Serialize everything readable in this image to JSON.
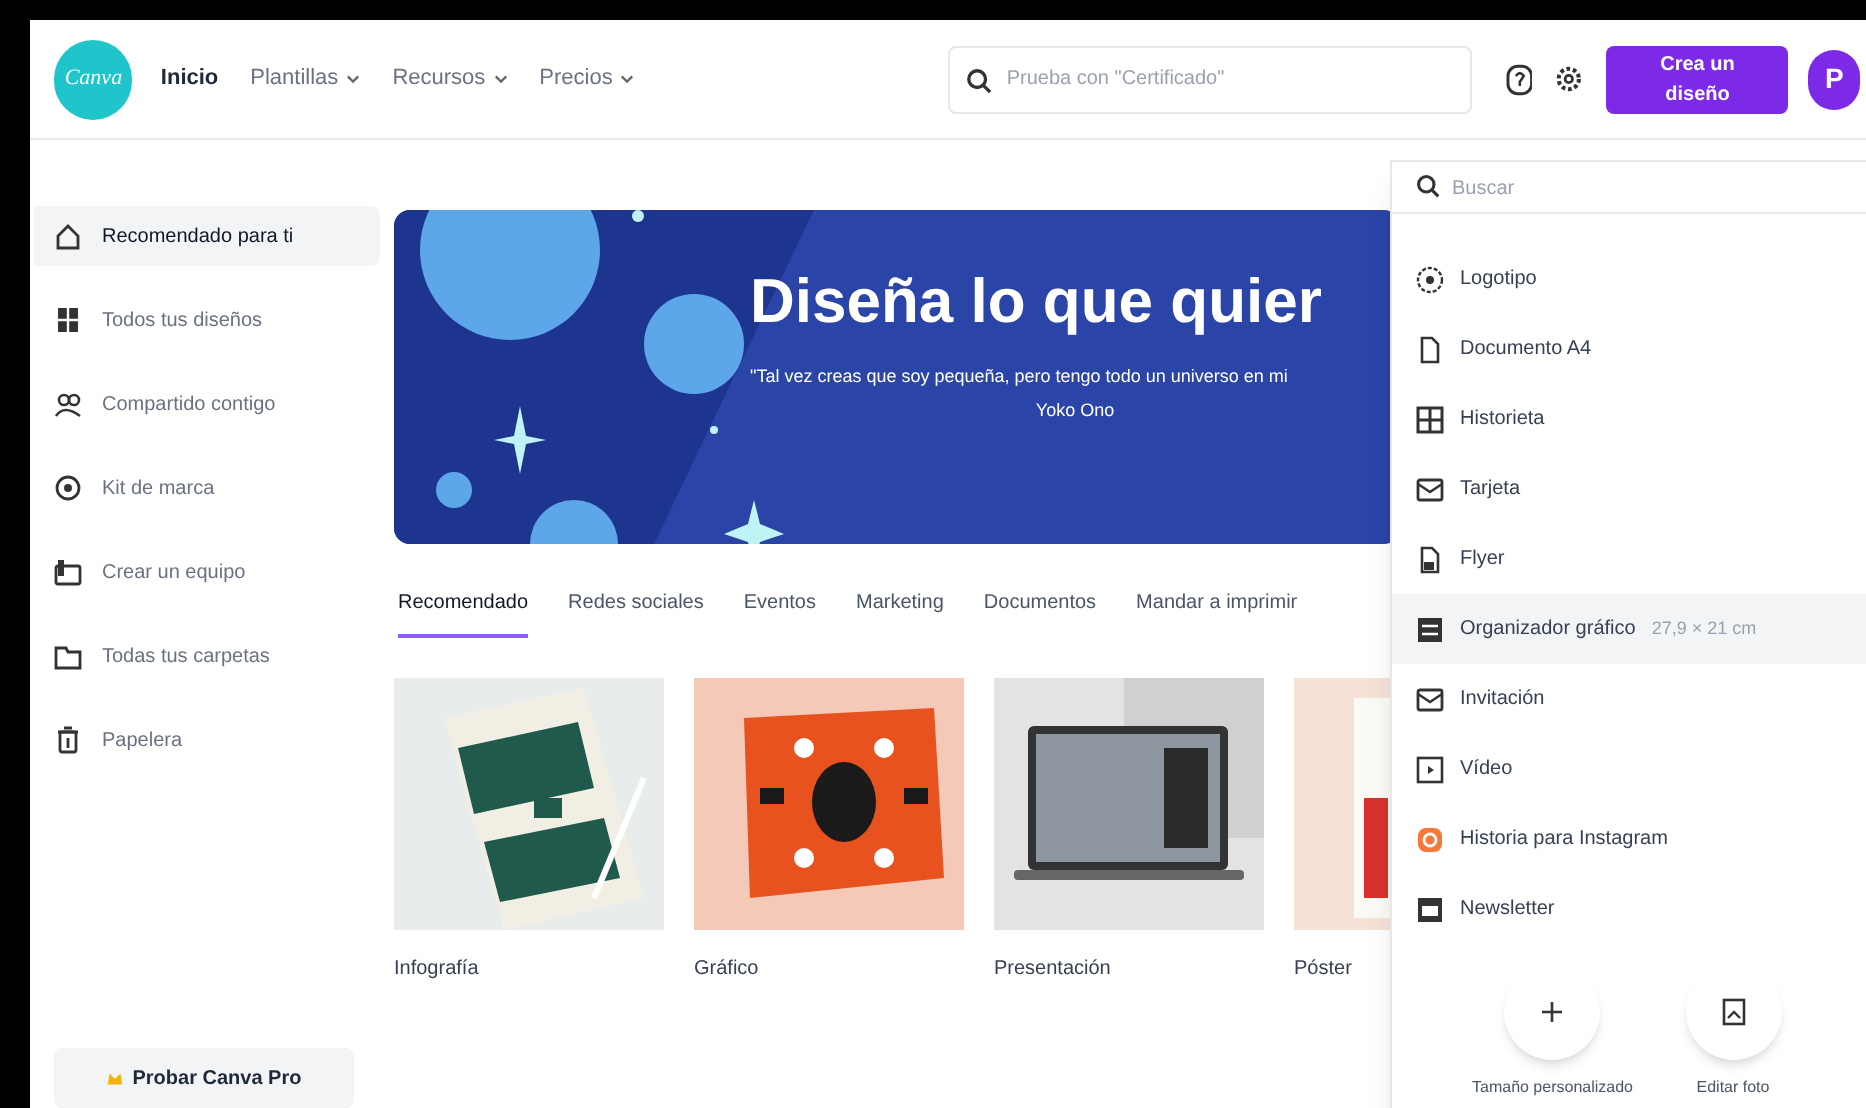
{
  "header": {
    "logo": "Canva",
    "nav": [
      {
        "label": "Inicio",
        "dropdown": false
      },
      {
        "label": "Plantillas",
        "dropdown": true
      },
      {
        "label": "Recursos",
        "dropdown": true
      },
      {
        "label": "Precios",
        "dropdown": true
      }
    ],
    "search": {
      "placeholder": "Prueba con \"Certificado\""
    },
    "create_button": "Crea un diseño",
    "avatar": "P"
  },
  "sidebar": {
    "items": [
      {
        "label": "Recomendado para ti",
        "selected": true
      },
      {
        "label": "Todos tus diseños",
        "selected": false
      },
      {
        "label": "Compartido contigo",
        "selected": false
      },
      {
        "label": "Kit de marca",
        "selected": false
      },
      {
        "label": "Crear un equipo",
        "selected": false
      },
      {
        "label": "Todas tus carpetas",
        "selected": false
      },
      {
        "label": "Papelera",
        "selected": false
      }
    ],
    "pro_button": "Probar Canva Pro"
  },
  "banner": {
    "title": "Diseña lo que quier",
    "quote": "\"Tal vez creas que soy pequeña, pero tengo todo un universo en mi",
    "author": "Yoko Ono"
  },
  "tabs": [
    {
      "label": "Recomendado",
      "selected": true
    },
    {
      "label": "Redes sociales",
      "selected": false
    },
    {
      "label": "Eventos",
      "selected": false
    },
    {
      "label": "Marketing",
      "selected": false
    },
    {
      "label": "Documentos",
      "selected": false
    },
    {
      "label": "Mandar a imprimir",
      "selected": false
    }
  ],
  "cards": [
    {
      "label": "Infografía",
      "kind": "picture"
    },
    {
      "label": "Gráfico",
      "kind": "picture"
    },
    {
      "label": "Presentación",
      "kind": "picture"
    },
    {
      "label": "Póster",
      "kind": "picture"
    }
  ],
  "dropdown": {
    "search": {
      "placeholder": "Buscar"
    },
    "items": [
      {
        "label": "Logotipo",
        "selected": false
      },
      {
        "label": "Documento A4",
        "selected": false
      },
      {
        "label": "Historieta",
        "selected": false
      },
      {
        "label": "Tarjeta",
        "selected": false
      },
      {
        "label": "Flyer",
        "selected": false
      },
      {
        "label": "Organizador gráfico",
        "size": "27,9 × 21 cm",
        "selected": true
      },
      {
        "label": "Invitación",
        "selected": false
      },
      {
        "label": "Vídeo",
        "selected": false
      },
      {
        "label": "Historia para Instagram",
        "selected": false
      },
      {
        "label": "Newsletter",
        "selected": false
      }
    ],
    "actions": [
      {
        "label": "Tamaño personalizado"
      },
      {
        "label": "Editar foto"
      }
    ]
  }
}
